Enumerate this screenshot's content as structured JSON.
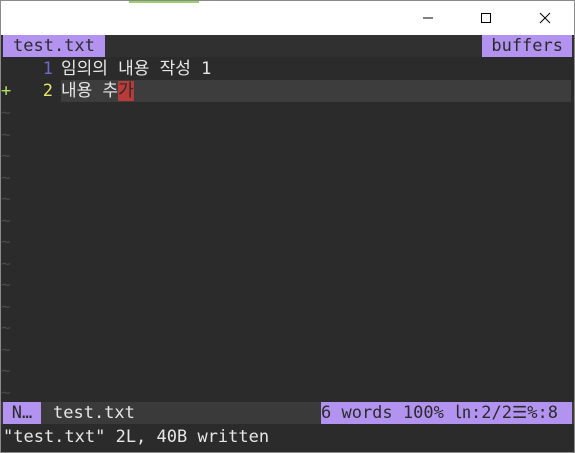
{
  "window": {
    "accent_color": "#9ccf6a"
  },
  "tabline": {
    "active_tab": "test.txt",
    "right_label": "buffers"
  },
  "editor": {
    "lines": [
      {
        "number": "1",
        "text": "임의의 내용 작성 1",
        "sign": ""
      },
      {
        "number": "2",
        "text_before_cursor": "내용 추",
        "cursor_char": "가",
        "sign": "+"
      }
    ],
    "tilde": "~"
  },
  "statusline": {
    "mode": "N…",
    "filename": "test.txt",
    "right": "6 words 100% ㏑:2/2☰%:8"
  },
  "cmdline": {
    "message": "\"test.txt\" 2L, 40B written"
  },
  "colors": {
    "accent": "#b393f0",
    "background": "#2b2b2b",
    "cursor": "#b83b3b",
    "git_add": "#b4e36a"
  }
}
